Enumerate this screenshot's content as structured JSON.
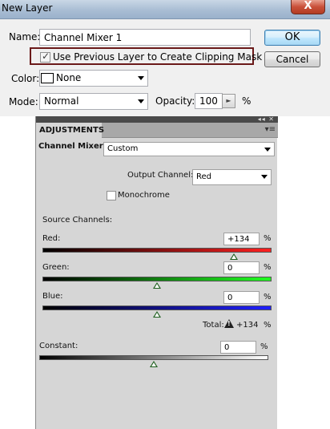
{
  "dialog": {
    "title": "New Layer",
    "close_label": "X",
    "name_label": "Name:",
    "name_value": "Channel Mixer 1",
    "ok_label": "OK",
    "cancel_label": "Cancel",
    "clip_checked": true,
    "clip_label": "Use Previous Layer to Create Clipping Mask",
    "color_label": "Color:",
    "color_value": "None",
    "mode_label": "Mode:",
    "mode_value": "Normal",
    "opacity_label": "Opacity:",
    "opacity_value": "100",
    "opacity_unit": "%"
  },
  "panel": {
    "tab_label": "ADJUSTMENTS",
    "adjustment_label": "Channel Mixer",
    "preset_value": "Custom",
    "output_channel_label": "Output Channel:",
    "output_channel_value": "Red",
    "monochrome_label": "Monochrome",
    "monochrome_checked": false,
    "source_channels_label": "Source Channels:",
    "channels": [
      {
        "label": "Red:",
        "value": "+134",
        "level": 134,
        "gradient_color": "#ff2020"
      },
      {
        "label": "Green:",
        "value": "0",
        "level": 0,
        "gradient_color": "#20ff20"
      },
      {
        "label": "Blue:",
        "value": "0",
        "level": 0,
        "gradient_color": "#2020ff"
      }
    ],
    "percent_sign": "%",
    "total_label": "Total:",
    "total_value": "+134",
    "constant_label": "Constant:",
    "constant_value": "0",
    "constant_level": 0
  },
  "colors": {
    "panel_bg": "#d6d6d6",
    "clip_highlight": "#6b1a1a",
    "ok_button_border": "#3c7fb1"
  }
}
